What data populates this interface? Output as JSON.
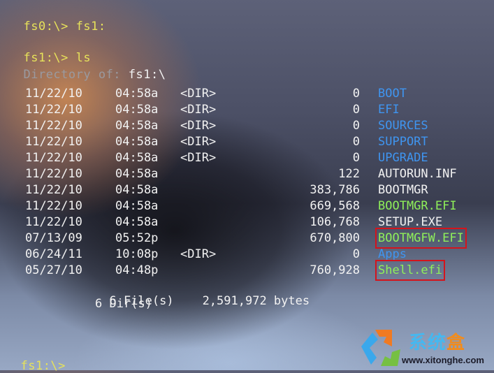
{
  "terminal": {
    "line1_prompt": "fs0:\\>",
    "line1_cmd": "fs1:",
    "line2_prompt": "fs1:\\>",
    "line2_cmd": "ls",
    "dir_label": "Directory of:",
    "dir_path": "fs1:\\",
    "entries": [
      {
        "date": "11/22/10",
        "time": "04:58a",
        "dir": "<DIR>",
        "size": "0",
        "name": "BOOT",
        "color": "blue",
        "highlighted": false
      },
      {
        "date": "11/22/10",
        "time": "04:58a",
        "dir": "<DIR>",
        "size": "0",
        "name": "EFI",
        "color": "blue",
        "highlighted": false
      },
      {
        "date": "11/22/10",
        "time": "04:58a",
        "dir": "<DIR>",
        "size": "0",
        "name": "SOURCES",
        "color": "blue",
        "highlighted": false
      },
      {
        "date": "11/22/10",
        "time": "04:58a",
        "dir": "<DIR>",
        "size": "0",
        "name": "SUPPORT",
        "color": "blue",
        "highlighted": false
      },
      {
        "date": "11/22/10",
        "time": "04:58a",
        "dir": "<DIR>",
        "size": "0",
        "name": "UPGRADE",
        "color": "blue",
        "highlighted": false
      },
      {
        "date": "11/22/10",
        "time": "04:58a",
        "dir": "",
        "size": "122",
        "name": "AUTORUN.INF",
        "color": "white",
        "highlighted": false
      },
      {
        "date": "11/22/10",
        "time": "04:58a",
        "dir": "",
        "size": "383,786",
        "name": "BOOTMGR",
        "color": "white",
        "highlighted": false
      },
      {
        "date": "11/22/10",
        "time": "04:58a",
        "dir": "",
        "size": "669,568",
        "name": "BOOTMGR.EFI",
        "color": "green",
        "highlighted": false
      },
      {
        "date": "11/22/10",
        "time": "04:58a",
        "dir": "",
        "size": "106,768",
        "name": "SETUP.EXE",
        "color": "white",
        "highlighted": false
      },
      {
        "date": "07/13/09",
        "time": "05:52p",
        "dir": "",
        "size": "670,800",
        "name": "BOOTMGFW.EFI",
        "color": "green",
        "highlighted": true
      },
      {
        "date": "06/24/11",
        "time": "10:08p",
        "dir": "<DIR>",
        "size": "0",
        "name": "Apps",
        "color": "blue",
        "highlighted": false
      },
      {
        "date": "05/27/10",
        "time": "04:48p",
        "dir": "",
        "size": "760,928",
        "name": "Shell.efi",
        "color": "green",
        "highlighted": true
      }
    ],
    "summary_files": "6 File(s)",
    "summary_bytes": "2,591,972 bytes",
    "summary_dirs": "6 Dir(s)",
    "final_prompt": "fs1:\\>"
  },
  "watermark": {
    "name_main": "系统",
    "name_last": "盒",
    "url": "www.xitonghe.com"
  }
}
